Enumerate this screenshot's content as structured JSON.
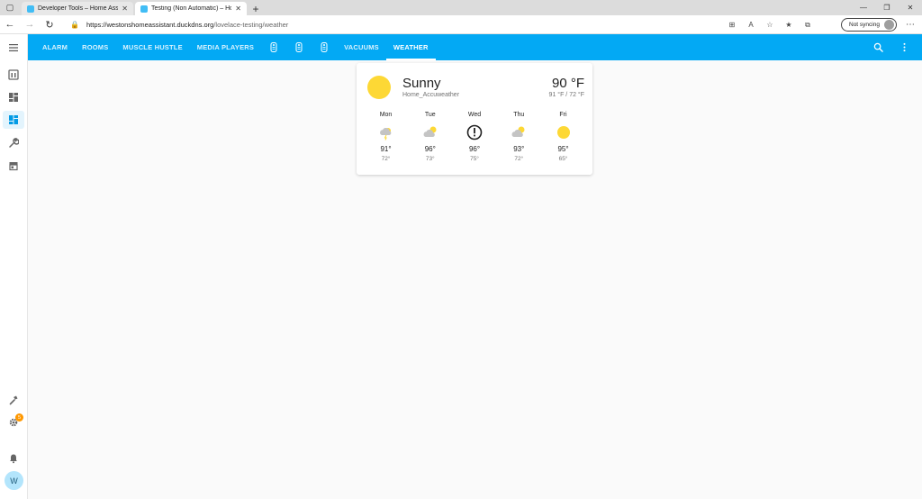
{
  "browser": {
    "tabs": [
      {
        "title": "Developer Tools – Home Assista",
        "active": false
      },
      {
        "title": "Testing (Non Automatic) – Home",
        "active": true
      }
    ],
    "url_host": "https://westonshomeassistant.duckdns.org",
    "url_path": "/lovelace-testing/weather",
    "sync_label": "Not syncing"
  },
  "header": {
    "views": [
      {
        "label": "ALARM"
      },
      {
        "label": "ROOMS"
      },
      {
        "label": "MUSCLE HUSTLE"
      },
      {
        "label": "MEDIA PLAYERS"
      },
      {
        "label": ""
      },
      {
        "label": ""
      },
      {
        "label": ""
      },
      {
        "label": "VACUUMS"
      },
      {
        "label": "WEATHER"
      }
    ],
    "active_view": "WEATHER"
  },
  "sidebar": {
    "notification_count": "5",
    "user_initial": "W"
  },
  "weather": {
    "condition": "Sunny",
    "source": "Home_Accuweather",
    "temperature": "90 °F",
    "high_low": "91 °F / 72 °F",
    "forecast": [
      {
        "day": "Mon",
        "icon": "cloudy-lightning-icon",
        "high": "91°",
        "low": "72°"
      },
      {
        "day": "Tue",
        "icon": "partly-cloudy-icon",
        "high": "96°",
        "low": "73°"
      },
      {
        "day": "Wed",
        "icon": "exceptional-alert-icon",
        "high": "96°",
        "low": "75°"
      },
      {
        "day": "Thu",
        "icon": "partly-cloudy-icon",
        "high": "93°",
        "low": "72°"
      },
      {
        "day": "Fri",
        "icon": "sunny-icon",
        "high": "95°",
        "low": "65°"
      }
    ]
  },
  "colors": {
    "header": "#03a9f4",
    "sun": "#fdd835",
    "badge": "#ff9800"
  }
}
